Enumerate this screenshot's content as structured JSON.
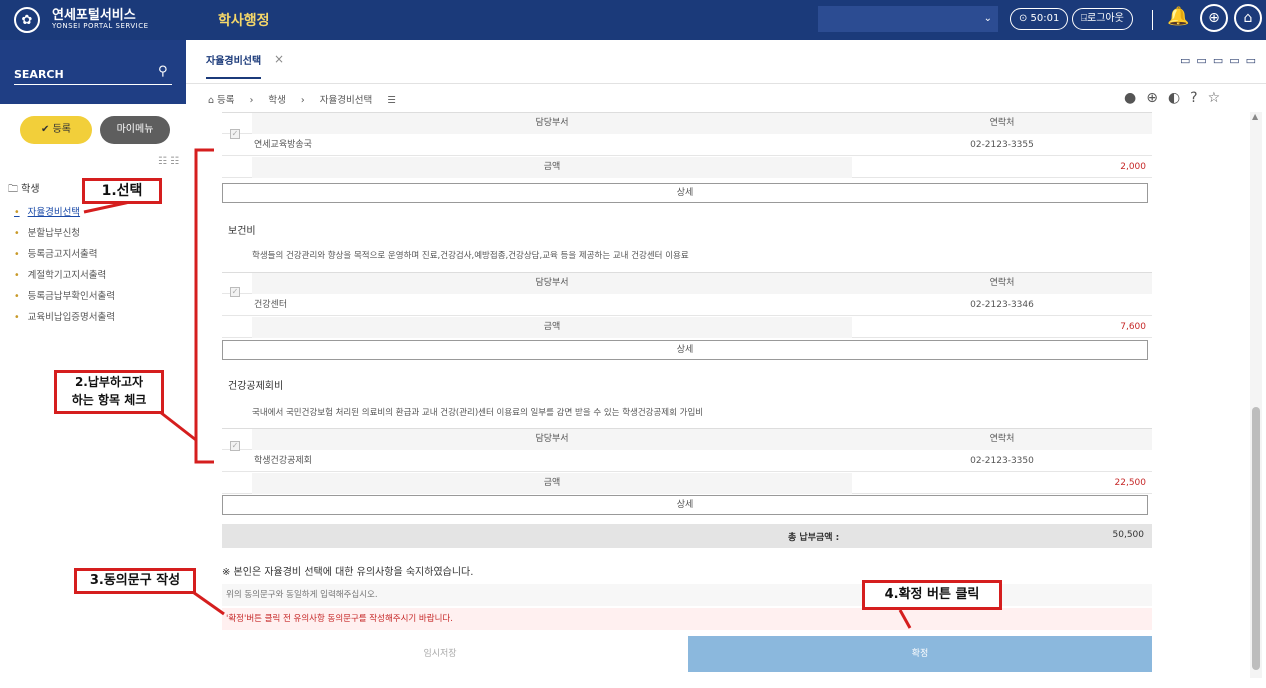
{
  "header": {
    "logo_symbol": "✿",
    "brand_name": "연세포털서비스",
    "brand_sub": "YONSEI PORTAL SERVICE",
    "menu_title": "학사행정",
    "select_caret": "⌄",
    "timer": "⊙ 50:01",
    "logout": "⍈로그아웃",
    "bell_icon": "🔔",
    "globe_icon": "⊕",
    "home_icon": "⌂"
  },
  "sidebar": {
    "search_label": "SEARCH",
    "search_icon": "⚲",
    "main_button": "✔  등록",
    "my_menu_button": "마이메뉴",
    "tree_tools": "☷ ☷",
    "root_label": "🗀  학생",
    "items": [
      {
        "label": "자율경비선택"
      },
      {
        "label": "분할납부신청"
      },
      {
        "label": "등록금고지서출력"
      },
      {
        "label": "계절학기고지서출력"
      },
      {
        "label": "등록금납부확인서출력"
      },
      {
        "label": "교육비납입증명서출력"
      }
    ],
    "bullet": "•"
  },
  "tabs": {
    "active_tab": "자율경비선택",
    "close_icon": "×",
    "window_icons": "▭▭▭▭▭"
  },
  "breadcrumb": {
    "home": "⌂ 등록",
    "sep": "›",
    "level1": "학생",
    "level2": "자율경비선택",
    "menu_icon": "☰"
  },
  "toolbar_icons": "●⊕◐?☆",
  "sections": [
    {
      "title": "",
      "desc": "",
      "dept_header": "담당부서",
      "contact_header": "연락처",
      "dept": "연세교육방송국",
      "contact": "02-2123-3355",
      "amount_label": "금액",
      "amount": "2,000",
      "detail": "상세"
    },
    {
      "title": "보건비",
      "desc": "학생들의 건강관리와 향상을 목적으로 운영하며 진료,건강검사,예방접종,건강상담,교육 등을 제공하는 교내 건강센터 이용료",
      "dept_header": "담당부서",
      "contact_header": "연락처",
      "dept": "건강센터",
      "contact": "02-2123-3346",
      "amount_label": "금액",
      "amount": "7,600",
      "detail": "상세"
    },
    {
      "title": "건강공제회비",
      "desc": "국내에서 국민건강보험 처리된 의료비의 환급과 교내 건강(관리)센터 이용료의 일부를 감면 받을 수 있는 학생건강공제회 가입비",
      "dept_header": "담당부서",
      "contact_header": "연락처",
      "dept": "학생건강공제회",
      "contact": "02-2123-3350",
      "amount_label": "금액",
      "amount": "22,500",
      "detail": "상세"
    }
  ],
  "checkbox_mark": "✓",
  "total": {
    "label": "총 납부금액 :",
    "value": "50,500"
  },
  "consent": {
    "title": "※ 본인은 자율경비 선택에 대한 유의사항을 숙지하였습니다.",
    "placeholder": "위의 동의문구와 동일하게 입력해주십시오.",
    "warning": "'확정'버튼 클릭 전 유의사항 동의문구를 작성해주시기 바랍니다."
  },
  "buttons": {
    "temp_save": "임시저장",
    "confirm": "확정"
  },
  "scroll_up": "▲",
  "annotations": {
    "step1": "1.선택",
    "step2_line1": "2.납부하고자",
    "step2_line2": "하는 항목 체크",
    "step3": "3.동의문구 작성",
    "step4": "4.확정 버튼 클릭",
    "color": "#d51e1e"
  }
}
